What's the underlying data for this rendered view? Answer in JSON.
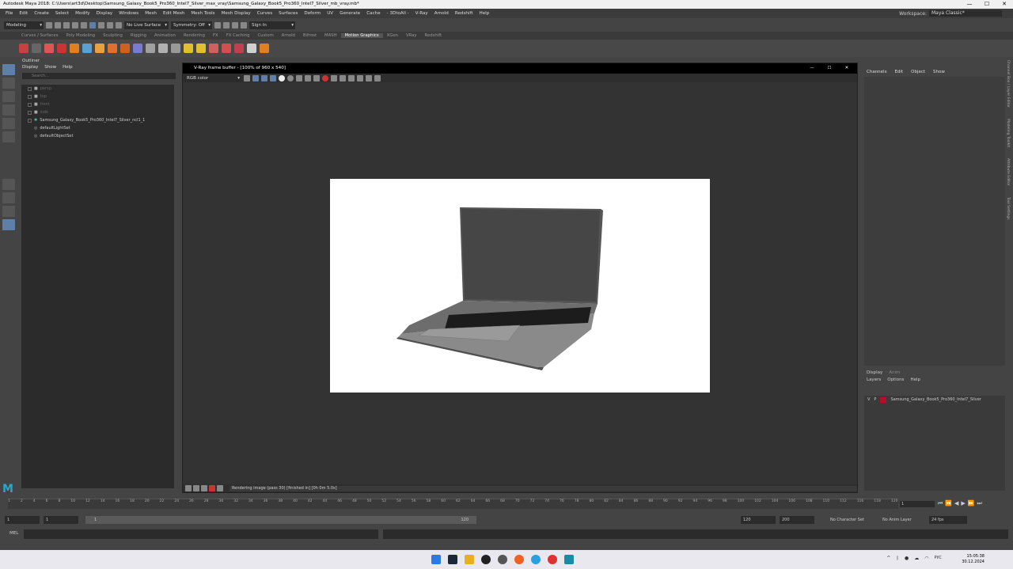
{
  "window": {
    "title": "Autodesk Maya 2018: C:\\Users\\art3d\\Desktop\\Samsung_Galaxy_Book5_Pro360_Intel7_Silver_max_vray\\Samsung_Galaxy_Book5_Pro360_Intel7_Silver_mb_vray.mb*"
  },
  "menubar": [
    "File",
    "Edit",
    "Create",
    "Select",
    "Modify",
    "Display",
    "Windows",
    "Mesh",
    "Edit Mesh",
    "Mesh Tools",
    "Mesh Display",
    "Curves",
    "Surfaces",
    "Deform",
    "UV",
    "Generate",
    "Cache",
    "- 3DtoAll -",
    "V-Ray",
    "Arnold",
    "Redshift",
    "Help"
  ],
  "workspace": {
    "label": "Workspace:",
    "value": "Maya Classic*"
  },
  "statusline": {
    "mode": "Modeling",
    "live_surface": "No Live Surface",
    "symmetry": "Symmetry: Off",
    "sign_in": "Sign In"
  },
  "shelf_tabs": [
    "Curves / Surfaces",
    "Poly Modeling",
    "Sculpting",
    "Rigging",
    "Animation",
    "Rendering",
    "FX",
    "FX Caching",
    "Custom",
    "Arnold",
    "Bifrost",
    "MASH",
    "Motion Graphics",
    "XGen",
    "VRay",
    "Redshift"
  ],
  "active_shelf": "Motion Graphics",
  "outliner": {
    "title": "Outliner",
    "menu": [
      "Display",
      "Show",
      "Help"
    ],
    "search_placeholder": "Search...",
    "items": [
      {
        "label": "persp",
        "dim": true
      },
      {
        "label": "top",
        "dim": true
      },
      {
        "label": "front",
        "dim": true
      },
      {
        "label": "side",
        "dim": true
      },
      {
        "label": "Samsung_Galaxy_Book5_Pro360_Intel7_Silver_ncl1_1",
        "dim": false
      },
      {
        "label": "defaultLightSet",
        "dim": false
      },
      {
        "label": "defaultObjectSet",
        "dim": false
      }
    ]
  },
  "vfb": {
    "title": "V-Ray frame buffer - [100% of 960 x 540]",
    "channel": "RGB color",
    "status": "Rendering image (pass 30) [finished in] [0h 0m 5.0s]"
  },
  "channel_box": {
    "menu": [
      "Channels",
      "Edit",
      "Object",
      "Show"
    ],
    "side_tabs": [
      "Channel Box / Layer Editor",
      "Modeling Toolkit",
      "Attribute Editor",
      "Tool Settings"
    ]
  },
  "layer_editor": {
    "tabs": [
      "Display",
      "Anim"
    ],
    "menu": [
      "Layers",
      "Options",
      "Help"
    ],
    "layer": {
      "v": "V",
      "p": "P",
      "name": "Samsung_Galaxy_Book5_Pro360_Intel7_Silver",
      "color": "#b0102a"
    }
  },
  "timeline": {
    "ticks": [
      "1",
      "2",
      "4",
      "6",
      "8",
      "10",
      "12",
      "14",
      "16",
      "18",
      "20",
      "22",
      "24",
      "26",
      "28",
      "30",
      "32",
      "34",
      "36",
      "38",
      "40",
      "42",
      "44",
      "46",
      "48",
      "50",
      "52",
      "54",
      "56",
      "58",
      "60",
      "62",
      "64",
      "66",
      "68",
      "70",
      "72",
      "74",
      "76",
      "78",
      "80",
      "82",
      "84",
      "86",
      "88",
      "90",
      "92",
      "94",
      "96",
      "98",
      "100",
      "102",
      "104",
      "106",
      "108",
      "110",
      "112",
      "116",
      "118",
      "120"
    ],
    "current_frame": "1"
  },
  "range": {
    "start": "1",
    "start2": "1",
    "slider_start": "1",
    "slider_end": "120",
    "end": "120",
    "end2": "200",
    "character": "No Character Set",
    "anim_layer": "No Anim Layer",
    "fps": "24 fps"
  },
  "cmdline": {
    "label": "MEL"
  },
  "taskbar": {
    "lang": "РУС",
    "time": "15:05:38",
    "date": "30.12.2024"
  }
}
